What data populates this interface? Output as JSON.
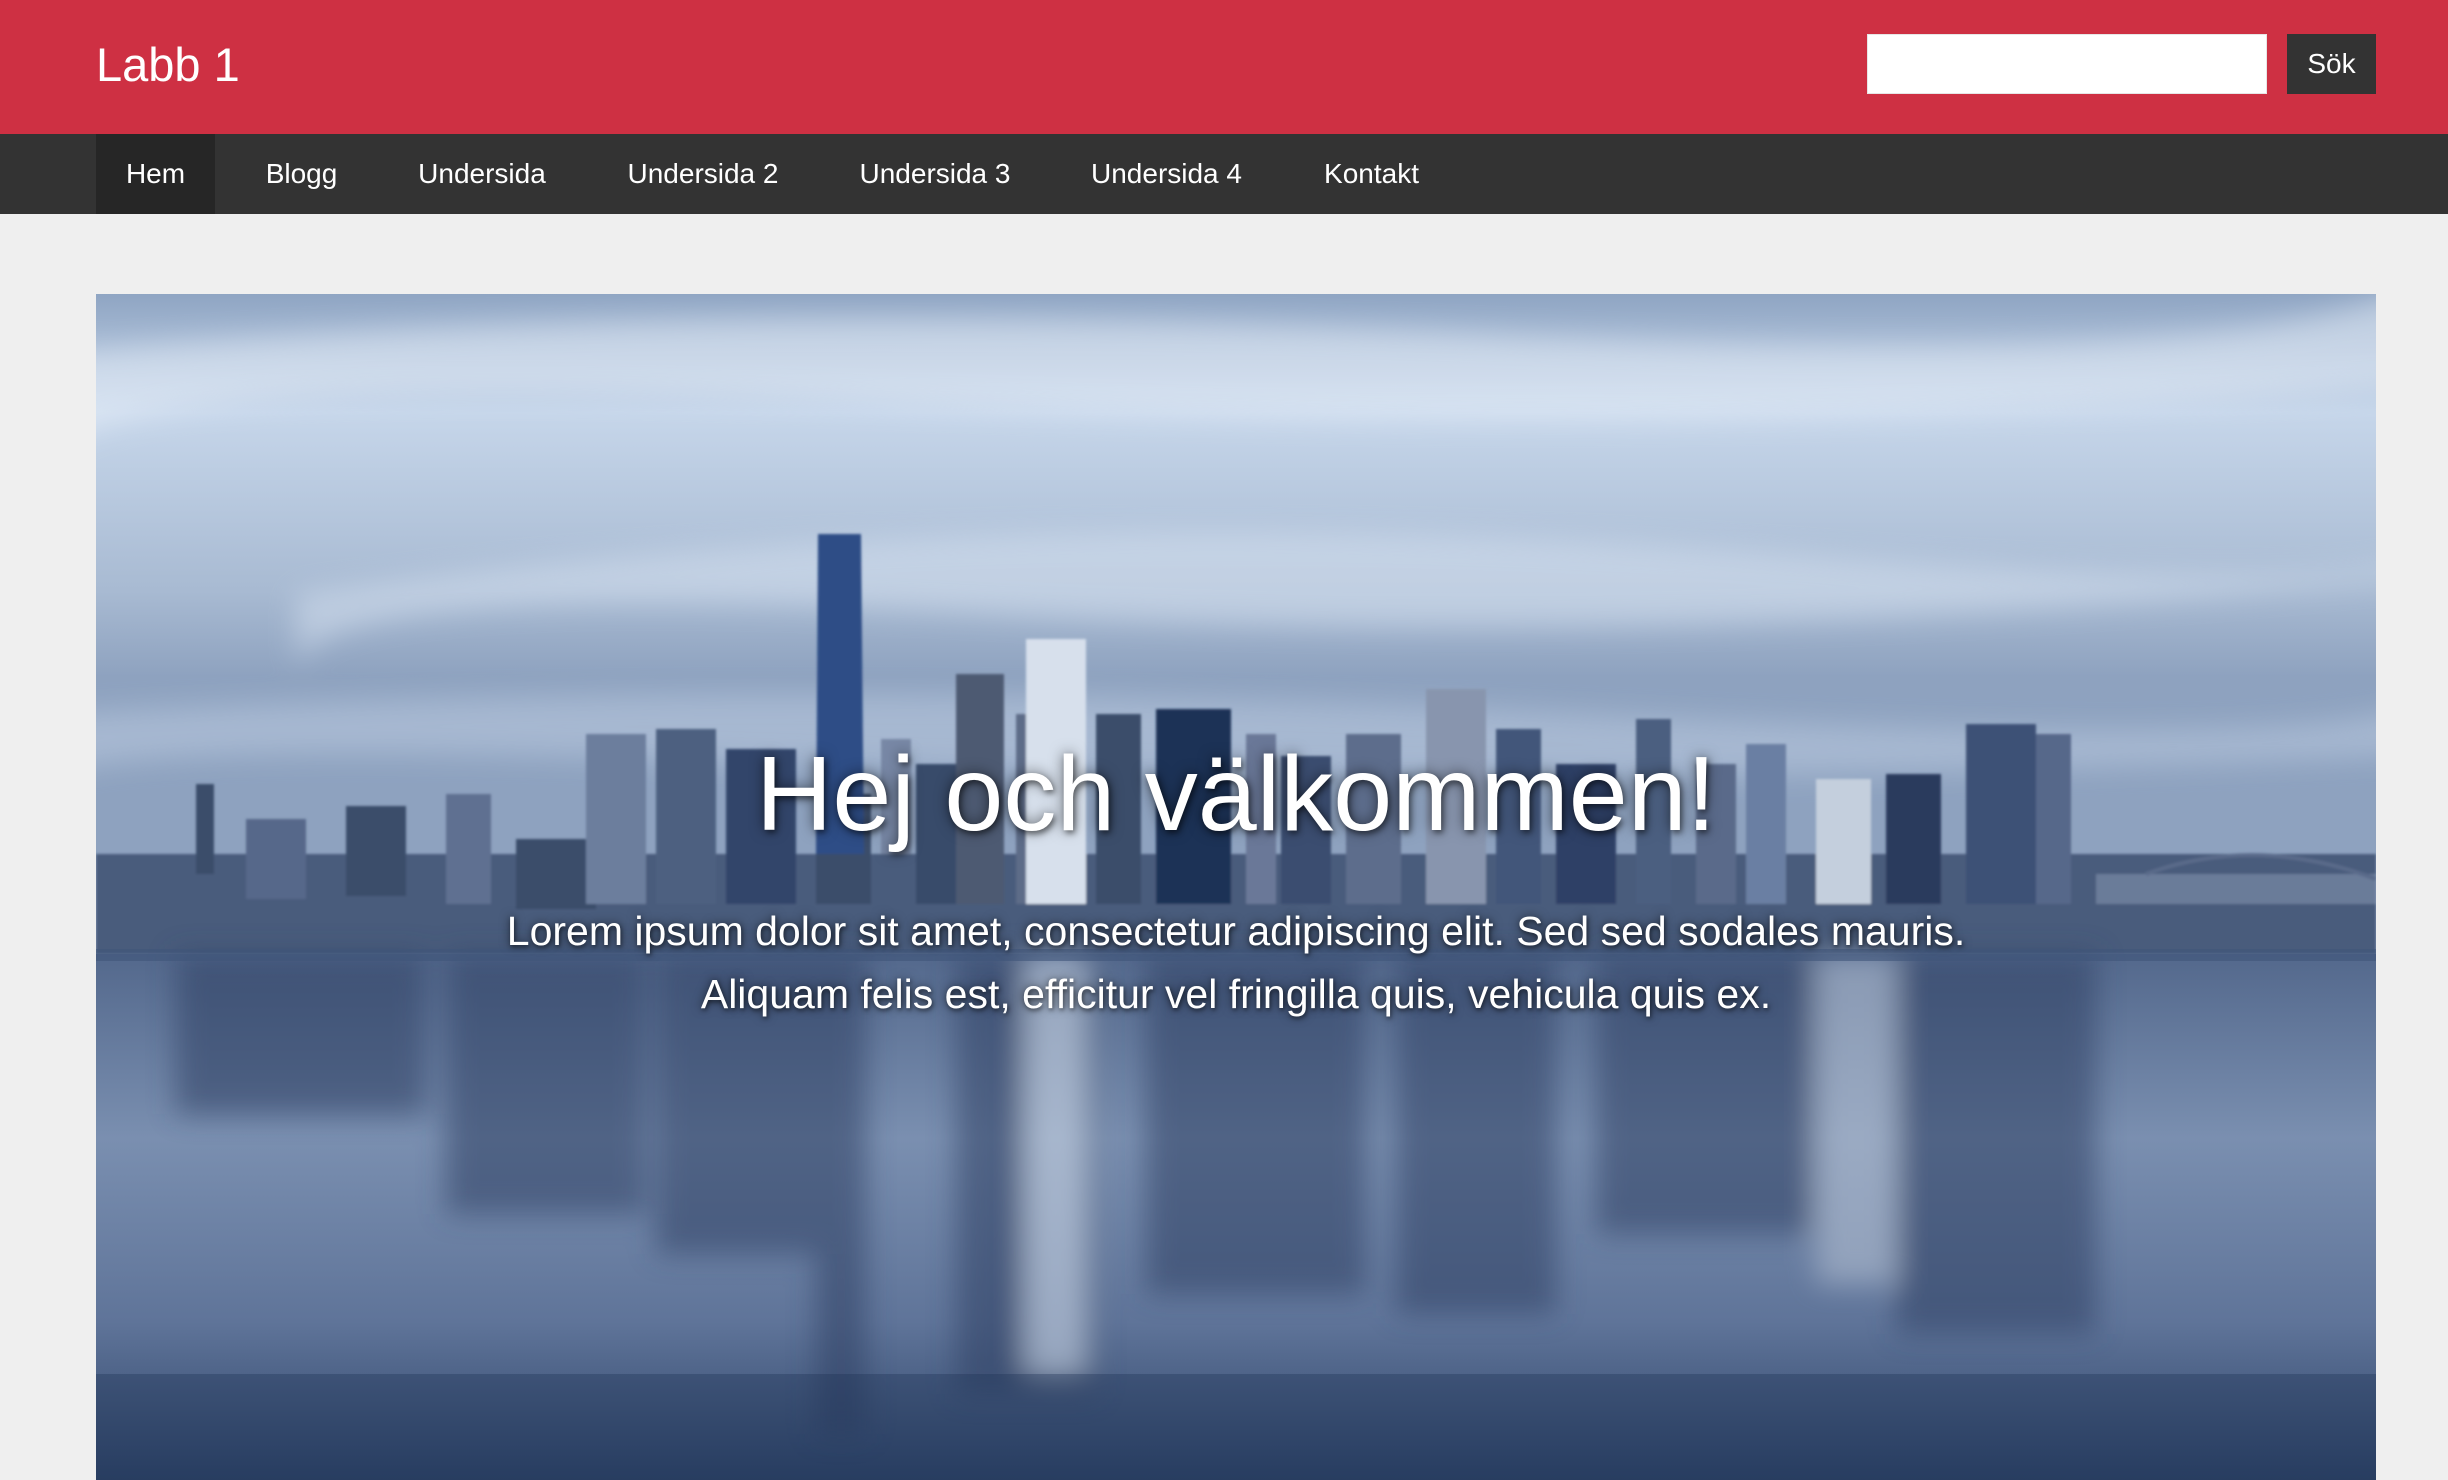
{
  "header": {
    "site_title": "Labb 1",
    "search": {
      "value": "",
      "placeholder": "",
      "button_label": "Sök"
    }
  },
  "nav": {
    "active_item": "Hem",
    "items": [
      {
        "label": "Hem"
      },
      {
        "label": "Blogg"
      },
      {
        "label": "Undersida"
      },
      {
        "label": "Undersida 2"
      },
      {
        "label": "Undersida 3"
      },
      {
        "label": "Undersida 4"
      },
      {
        "label": "Kontakt"
      }
    ]
  },
  "hero": {
    "heading": "Hej och välkommen!",
    "text": "Lorem ipsum dolor sit amet, consectetur adipiscing elit. Sed sed sodales mauris. Aliquam felis est, efficitur vel fringilla quis, vehicula quis ex.",
    "background_image": "city-skyline-reflection"
  },
  "colors": {
    "header_bg": "#ce3043",
    "nav_bg": "#333333",
    "nav_active_bg": "#262626",
    "page_bg": "#efefef",
    "button_bg": "#333333",
    "text_light": "#ffffff"
  }
}
